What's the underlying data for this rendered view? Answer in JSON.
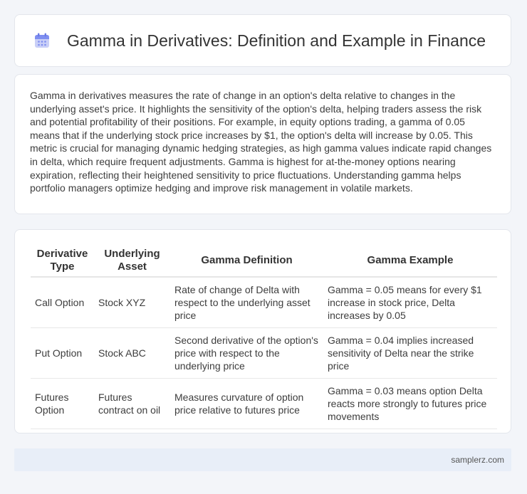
{
  "header": {
    "title": "Gamma in Derivatives: Definition and Example in Finance",
    "icon": "calendar-icon"
  },
  "intro": {
    "text": "Gamma in derivatives measures the rate of change in an option's delta relative to changes in the underlying asset's price. It highlights the sensitivity of the option's delta, helping traders assess the risk and potential profitability of their positions. For example, in equity options trading, a gamma of 0.05 means that if the underlying stock price increases by $1, the option's delta will increase by 0.05. This metric is crucial for managing dynamic hedging strategies, as high gamma values indicate rapid changes in delta, which require frequent adjustments. Gamma is highest for at-the-money options nearing expiration, reflecting their heightened sensitivity to price fluctuations. Understanding gamma helps portfolio managers optimize hedging and improve risk management in volatile markets."
  },
  "table": {
    "headers": [
      "Derivative Type",
      "Underlying Asset",
      "Gamma Definition",
      "Gamma Example"
    ],
    "rows": [
      [
        "Call Option",
        "Stock XYZ",
        "Rate of change of Delta with respect to the underlying asset price",
        "Gamma = 0.05 means for every $1 increase in stock price, Delta increases by 0.05"
      ],
      [
        "Put Option",
        "Stock ABC",
        "Second derivative of the option's price with respect to the underlying price",
        "Gamma = 0.04 implies increased sensitivity of Delta near the strike price"
      ],
      [
        "Futures Option",
        "Futures contract on oil",
        "Measures curvature of option price relative to futures price",
        "Gamma = 0.03 means option Delta reacts more strongly to futures price movements"
      ]
    ]
  },
  "footer": {
    "text": "samplerz.com"
  }
}
